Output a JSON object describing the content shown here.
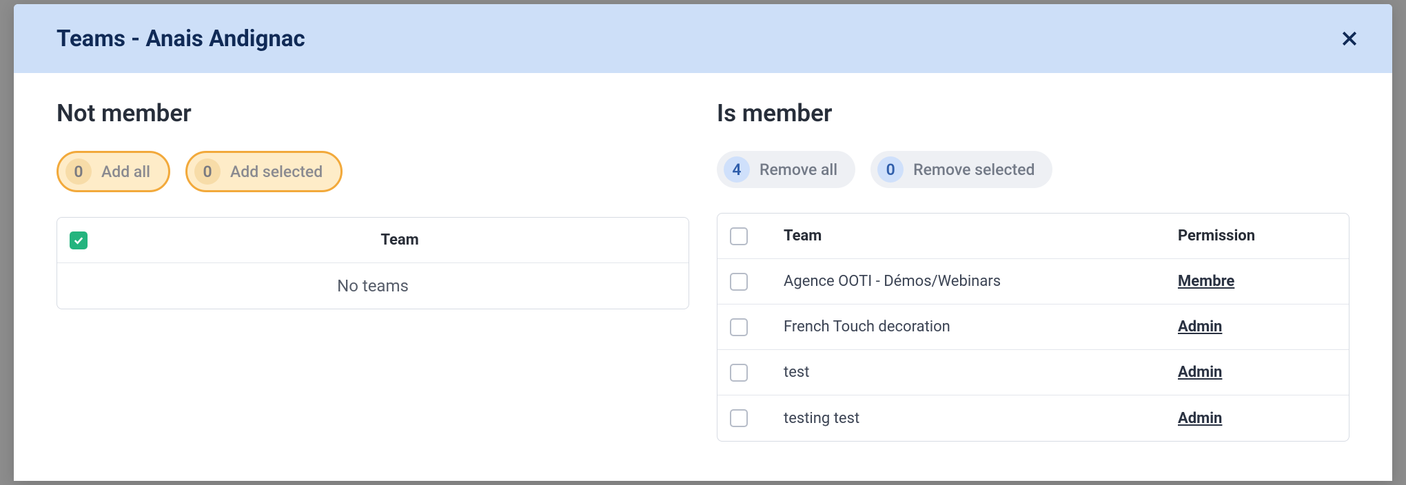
{
  "header": {
    "title": "Teams - Anais Andignac"
  },
  "left": {
    "title": "Not member",
    "pills": {
      "add_all": {
        "count": "0",
        "label": "Add all"
      },
      "add_selected": {
        "count": "0",
        "label": "Add selected"
      }
    },
    "columns": {
      "team": "Team"
    },
    "empty": "No teams"
  },
  "right": {
    "title": "Is member",
    "pills": {
      "remove_all": {
        "count": "4",
        "label": "Remove all"
      },
      "remove_selected": {
        "count": "0",
        "label": "Remove selected"
      }
    },
    "columns": {
      "team": "Team",
      "permission": "Permission"
    },
    "rows": [
      {
        "team": "Agence OOTI - Démos/Webinars",
        "permission": "Membre"
      },
      {
        "team": "French Touch decoration",
        "permission": "Admin"
      },
      {
        "team": "test",
        "permission": "Admin"
      },
      {
        "team": "testing test",
        "permission": "Admin"
      }
    ]
  }
}
